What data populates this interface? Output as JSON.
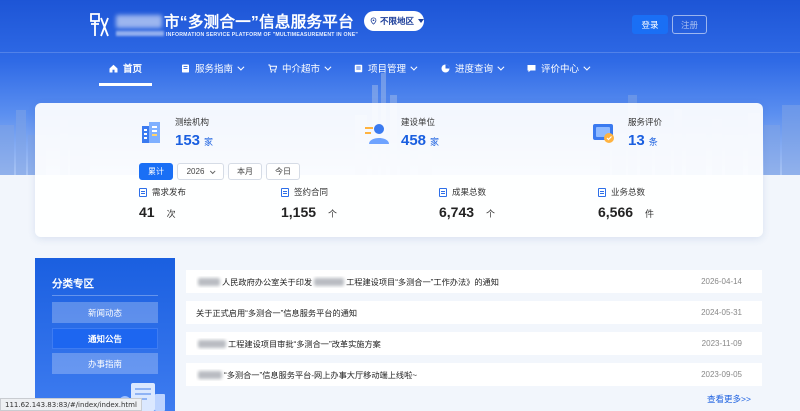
{
  "header": {
    "site_title_suffix": "市“多测合一”信息服务平台",
    "site_subtitle_suffix": "INFORMATION SERVICE PLATFORM OF \"MULTIMEASUREMENT IN ONE\"",
    "region_label": "不限地区",
    "login_label": "登录",
    "register_label": "注册"
  },
  "nav": {
    "items": [
      {
        "label": "首页",
        "icon": "home-icon"
      },
      {
        "label": "服务指南",
        "icon": "book-icon"
      },
      {
        "label": "中介超市",
        "icon": "cart-icon"
      },
      {
        "label": "项目管理",
        "icon": "project-icon"
      },
      {
        "label": "进度查询",
        "icon": "pie-icon"
      },
      {
        "label": "评价中心",
        "icon": "comment-icon"
      }
    ]
  },
  "stats": {
    "top": [
      {
        "label": "测绘机构",
        "value": "153",
        "unit": "家",
        "icon": "building-icon"
      },
      {
        "label": "建设单位",
        "value": "458",
        "unit": "家",
        "icon": "user-icon"
      },
      {
        "label": "服务评价",
        "value": "13",
        "unit": "条",
        "icon": "rating-icon"
      }
    ],
    "filters": {
      "cumulative": "累计",
      "year": "2026",
      "month": "本月",
      "today": "今日"
    },
    "bottom": [
      {
        "label": "需求发布",
        "value": "41",
        "unit": "次"
      },
      {
        "label": "签约合同",
        "value": "1,155",
        "unit": "个"
      },
      {
        "label": "成果总数",
        "value": "6,743",
        "unit": "个"
      },
      {
        "label": "业务总数",
        "value": "6,566",
        "unit": "件"
      }
    ]
  },
  "sidebar": {
    "title": "分类专区",
    "items": [
      "新闻动态",
      "通知公告",
      "办事指南"
    ]
  },
  "news": {
    "items": [
      {
        "title_a": "人民政府办公室关于印发",
        "title_b": "工程建设项目“多测合一”工作办法》的通知",
        "date": "2026-04-14"
      },
      {
        "title_a": "关于正式启用“多测合一”信息服务平台的通知",
        "title_b": "",
        "date": "2024-05-31"
      },
      {
        "title_a": "工程建设项目审批“多测合一”改革实施方案",
        "title_b": "",
        "date": "2023-11-09"
      },
      {
        "title_a": "“多测合一”信息服务平台-网上办事大厅移动端上线啦~",
        "title_b": "",
        "date": "2023-09-05"
      }
    ],
    "more_label": "查看更多>>"
  },
  "status_url": "111.62.143.83:83/#/index/index.html"
}
